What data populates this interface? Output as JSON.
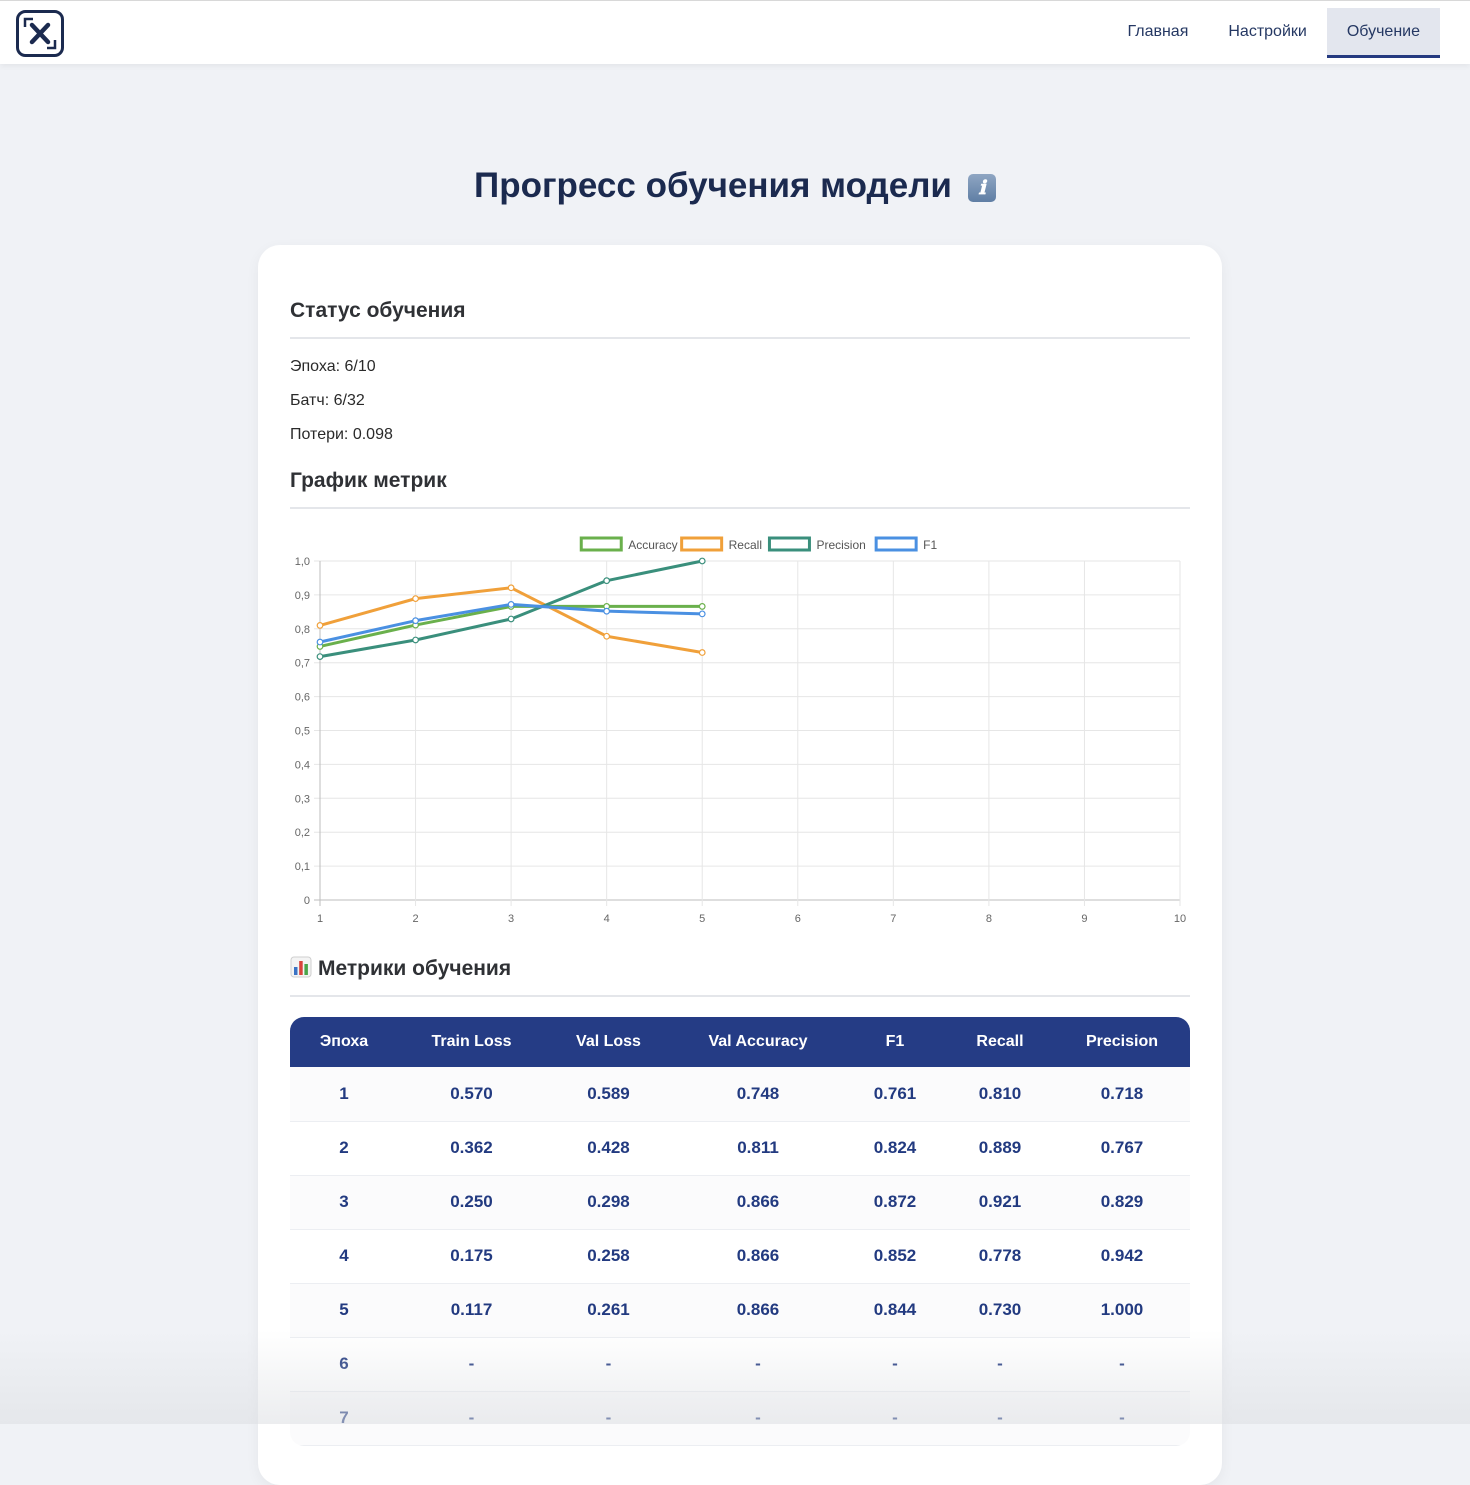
{
  "header": {
    "logo_icon": "close-x-frame-icon",
    "nav": [
      {
        "label": "Главная",
        "active": false
      },
      {
        "label": "Настройки",
        "active": false
      },
      {
        "label": "Обучение",
        "active": true
      }
    ]
  },
  "page": {
    "title": "Прогресс обучения модели",
    "info_icon": "ℹ"
  },
  "status": {
    "heading": "Статус обучения",
    "epoch": "Эпоха: 6/10",
    "batch": "Батч: 6/32",
    "loss": "Потери: 0.098"
  },
  "chart_section": {
    "heading": "График метрик"
  },
  "chart_data": {
    "type": "line",
    "x": [
      1,
      2,
      3,
      4,
      5,
      6,
      7,
      8,
      9,
      10
    ],
    "x_tick_labels": [
      "1",
      "2",
      "3",
      "4",
      "5",
      "6",
      "7",
      "8",
      "9",
      "10"
    ],
    "y_tick_labels": [
      "0",
      "0,1",
      "0,2",
      "0,3",
      "0,4",
      "0,5",
      "0,6",
      "0,7",
      "0,8",
      "0,9",
      "1,0"
    ],
    "xlim": [
      1,
      10
    ],
    "ylim": [
      0,
      1
    ],
    "grid": true,
    "legend_position": "top",
    "series": [
      {
        "name": "Accuracy",
        "color": "#6ab04c",
        "values": [
          0.748,
          0.811,
          0.866,
          0.866,
          0.866
        ]
      },
      {
        "name": "Recall",
        "color": "#f0a03a",
        "values": [
          0.81,
          0.889,
          0.921,
          0.778,
          0.73
        ]
      },
      {
        "name": "Precision",
        "color": "#3a8f7c",
        "values": [
          0.718,
          0.767,
          0.829,
          0.942,
          1.0
        ]
      },
      {
        "name": "F1",
        "color": "#4a90e2",
        "values": [
          0.761,
          0.824,
          0.872,
          0.852,
          0.844
        ]
      }
    ]
  },
  "metrics_section": {
    "heading": "Метрики обучения",
    "icon": "bar-chart-icon",
    "columns": [
      "Эпоха",
      "Train Loss",
      "Val Loss",
      "Val Accuracy",
      "F1",
      "Recall",
      "Precision"
    ],
    "rows": [
      [
        "1",
        "0.570",
        "0.589",
        "0.748",
        "0.761",
        "0.810",
        "0.718"
      ],
      [
        "2",
        "0.362",
        "0.428",
        "0.811",
        "0.824",
        "0.889",
        "0.767"
      ],
      [
        "3",
        "0.250",
        "0.298",
        "0.866",
        "0.872",
        "0.921",
        "0.829"
      ],
      [
        "4",
        "0.175",
        "0.258",
        "0.866",
        "0.852",
        "0.778",
        "0.942"
      ],
      [
        "5",
        "0.117",
        "0.261",
        "0.866",
        "0.844",
        "0.730",
        "1.000"
      ],
      [
        "6",
        "-",
        "-",
        "-",
        "-",
        "-",
        "-"
      ],
      [
        "7",
        "-",
        "-",
        "-",
        "-",
        "-",
        "-"
      ]
    ]
  }
}
